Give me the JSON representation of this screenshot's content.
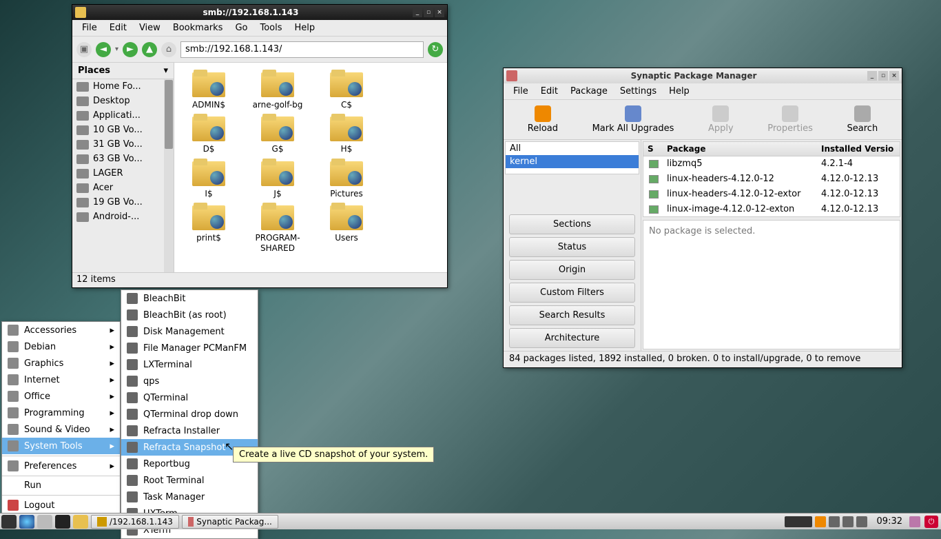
{
  "file_manager": {
    "title": "smb://192.168.1.143",
    "menus": [
      "File",
      "Edit",
      "View",
      "Bookmarks",
      "Go",
      "Tools",
      "Help"
    ],
    "address": "smb://192.168.1.143/",
    "sidebar_header": "Places",
    "places": [
      "Home Fo...",
      "Desktop",
      "Applicati...",
      "10 GB Vo...",
      "31 GB Vo...",
      "63 GB Vo...",
      "LAGER",
      "Acer",
      "19 GB Vo...",
      "Android-..."
    ],
    "folders": [
      "ADMIN$",
      "arne-golf-bg",
      "C$",
      "D$",
      "G$",
      "H$",
      "I$",
      "J$",
      "Pictures",
      "print$",
      "PROGRAM-SHARED",
      "Users"
    ],
    "status": "12 items"
  },
  "synaptic": {
    "title": "Synaptic Package Manager",
    "menus": [
      "File",
      "Edit",
      "Package",
      "Settings",
      "Help"
    ],
    "toolbar": {
      "reload": "Reload",
      "mark": "Mark All Upgrades",
      "apply": "Apply",
      "properties": "Properties",
      "search": "Search"
    },
    "filters": {
      "all": "All",
      "kernel": "kernel"
    },
    "category_buttons": [
      "Sections",
      "Status",
      "Origin",
      "Custom Filters",
      "Search Results",
      "Architecture"
    ],
    "pkg_header": {
      "s": "S",
      "package": "Package",
      "version": "Installed Versio"
    },
    "packages": [
      {
        "name": "libzmq5",
        "ver": "4.2.1-4"
      },
      {
        "name": "linux-headers-4.12.0-12",
        "ver": "4.12.0-12.13"
      },
      {
        "name": "linux-headers-4.12.0-12-extor",
        "ver": "4.12.0-12.13"
      },
      {
        "name": "linux-image-4.12.0-12-exton",
        "ver": "4.12.0-12.13"
      }
    ],
    "detail": "No package is selected.",
    "status": "84 packages listed, 1892 installed, 0 broken. 0 to install/upgrade, 0 to remove"
  },
  "start_menu": {
    "categories": [
      "Accessories",
      "Debian",
      "Graphics",
      "Internet",
      "Office",
      "Programming",
      "Sound & Video",
      "System Tools"
    ],
    "prefs": "Preferences",
    "run": "Run",
    "logout": "Logout"
  },
  "submenu": {
    "items": [
      "BleachBit",
      "BleachBit (as root)",
      "Disk Management",
      "File Manager PCManFM",
      "LXTerminal",
      "qps",
      "QTerminal",
      "QTerminal drop down",
      "Refracta Installer",
      "Refracta Snapshot",
      "Reportbug",
      "Root Terminal",
      "Task Manager",
      "UXTerm",
      "XTerm"
    ],
    "active_index": 9
  },
  "tooltip": "Create a live CD snapshot of your system.",
  "taskbar": {
    "tasks": [
      "/192.168.1.143",
      "Synaptic Packag..."
    ],
    "clock": "09:32"
  }
}
